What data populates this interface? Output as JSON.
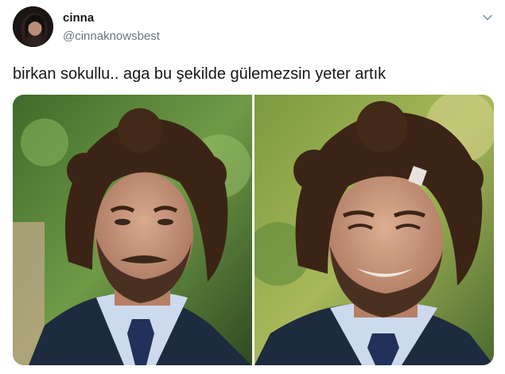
{
  "author": {
    "display_name": "cinna",
    "handle": "@cinnaknowsbest",
    "avatar_icon": "profile-photo"
  },
  "tweet": {
    "text": "birkan sokullu.. aga bu şekilde gülemezsin yeter artık"
  },
  "menu": {
    "icon": "chevron-down-icon"
  },
  "media": {
    "images": [
      {
        "name": "photo-serious"
      },
      {
        "name": "photo-smiling"
      }
    ]
  },
  "colors": {
    "text": "#14171a",
    "secondary": "#657786",
    "hair": "#3b2415",
    "skin": "#c99a82",
    "beard": "#4a3021",
    "suit": "#1e2a3e",
    "shirt": "#cdd9ec",
    "tie": "#22315a",
    "bg_green": "#5f8a3c"
  }
}
